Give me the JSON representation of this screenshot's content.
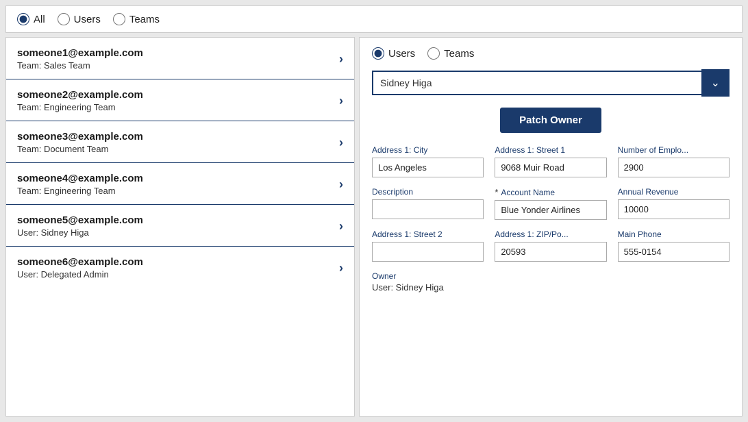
{
  "topFilter": {
    "options": [
      {
        "id": "all",
        "label": "All",
        "checked": true
      },
      {
        "id": "users",
        "label": "Users",
        "checked": false
      },
      {
        "id": "teams",
        "label": "Teams",
        "checked": false
      }
    ]
  },
  "listItems": [
    {
      "email": "someone1@example.com",
      "sub": "Team: Sales Team"
    },
    {
      "email": "someone2@example.com",
      "sub": "Team: Engineering Team"
    },
    {
      "email": "someone3@example.com",
      "sub": "Team: Document Team"
    },
    {
      "email": "someone4@example.com",
      "sub": "Team: Engineering Team"
    },
    {
      "email": "someone5@example.com",
      "sub": "User: Sidney Higa"
    },
    {
      "email": "someone6@example.com",
      "sub": "User: Delegated Admin"
    }
  ],
  "rightPanel": {
    "filterOptions": [
      {
        "id": "r-users",
        "label": "Users",
        "checked": true
      },
      {
        "id": "r-teams",
        "label": "Teams",
        "checked": false
      }
    ],
    "dropdown": {
      "value": "Sidney Higa",
      "placeholder": "Sidney Higa"
    },
    "patchOwnerButton": "Patch Owner",
    "fields": [
      {
        "label": "Address 1: City",
        "value": "Los Angeles",
        "required": false,
        "col": 1
      },
      {
        "label": "Address 1: Street 1",
        "value": "9068 Muir Road",
        "required": false,
        "col": 2
      },
      {
        "label": "Number of Emplo...",
        "value": "2900",
        "required": false,
        "col": 3
      },
      {
        "label": "Description",
        "value": "",
        "required": false,
        "col": 1
      },
      {
        "label": "Account Name",
        "value": "Blue Yonder Airlines",
        "required": true,
        "col": 2
      },
      {
        "label": "Annual Revenue",
        "value": "10000",
        "required": false,
        "col": 3
      },
      {
        "label": "Address 1: Street 2",
        "value": "",
        "required": false,
        "col": 1
      },
      {
        "label": "Address 1: ZIP/Po...",
        "value": "20593",
        "required": false,
        "col": 2
      },
      {
        "label": "Main Phone",
        "value": "555-0154",
        "required": false,
        "col": 3
      }
    ],
    "owner": {
      "label": "Owner",
      "value": "User: Sidney Higa"
    }
  }
}
